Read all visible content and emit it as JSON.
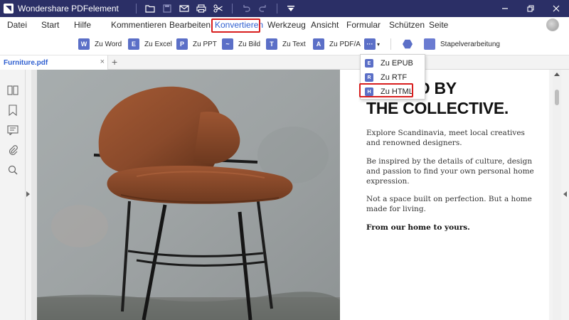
{
  "app": {
    "title": "Wondershare PDFelement"
  },
  "titlebar_icons": [
    "folder-icon",
    "save-icon",
    "mail-icon",
    "print-icon",
    "scissors-icon",
    "undo-icon",
    "redo-icon",
    "dropdown-icon"
  ],
  "window_controls": [
    "minimize-icon",
    "restore-icon",
    "close-icon"
  ],
  "menu": {
    "items": [
      {
        "label": "Datei"
      },
      {
        "label": "Start"
      },
      {
        "label": "Hilfe"
      },
      {
        "label": "Kommentieren"
      },
      {
        "label": "Bearbeiten"
      },
      {
        "label": "Konvertieren"
      },
      {
        "label": "Werkzeug"
      },
      {
        "label": "Ansicht"
      },
      {
        "label": "Formular"
      },
      {
        "label": "Schützen"
      },
      {
        "label": "Seite"
      }
    ],
    "active_index": 5
  },
  "toolbar": {
    "tools": [
      {
        "label": "Zu Word",
        "icon": "W",
        "icon_name": "word-icon"
      },
      {
        "label": "Zu Excel",
        "icon": "E",
        "icon_name": "excel-icon"
      },
      {
        "label": "Zu PPT",
        "icon": "P",
        "icon_name": "ppt-icon"
      },
      {
        "label": "Zu Bild",
        "icon": "~",
        "icon_name": "image-icon"
      },
      {
        "label": "Zu Text",
        "icon": "T",
        "icon_name": "text-icon"
      },
      {
        "label": "Zu PDF/A",
        "icon": "A",
        "icon_name": "pdfa-icon"
      }
    ],
    "more_icon": "more-icon",
    "batch_label": "Stapelverarbeitung"
  },
  "tabs": {
    "document": "Furniture.pdf",
    "close": "×",
    "add": "+"
  },
  "sidebar_icons": [
    "thumbnails-icon",
    "bookmark-icon",
    "comment-icon",
    "attachment-icon",
    "search-icon"
  ],
  "document": {
    "headline_line1": "ED BY",
    "headline_line2": "THE COLLECTIVE.",
    "paragraphs": [
      "Explore Scandinavia, meet local creatives and renowned designers.",
      "Be inspired by the details of culture, design and passion to find your own personal home expression.",
      "Not a space built on perfection. But a home made for living.",
      "From our home to yours."
    ]
  },
  "dropdown": {
    "items": [
      {
        "label": "Zu EPUB",
        "icon": "E"
      },
      {
        "label": "Zu RTF",
        "icon": "R"
      },
      {
        "label": "Zu HTML",
        "icon": "H"
      }
    ],
    "highlighted_index": 2
  },
  "colors": {
    "titlebar": "#2b2f66",
    "accent": "#2f5fd0",
    "highlight_red": "#d81e1e",
    "chair_leather": "#8a4a2b"
  }
}
